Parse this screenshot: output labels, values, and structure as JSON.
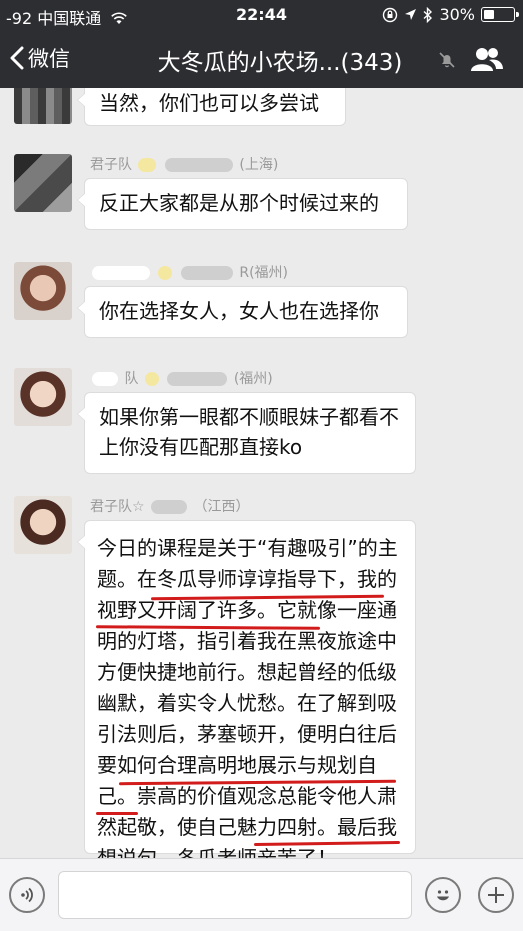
{
  "status_bar": {
    "carrier": "-92 中国联通",
    "time": "22:44",
    "battery": "30%",
    "battery_level": 0.3
  },
  "nav": {
    "back_label": "微信",
    "title": "大冬瓜的小农场...(343)"
  },
  "messages": [
    {
      "sender": "",
      "text": "当然，你们也可以多尝试"
    },
    {
      "sender": "君子队",
      "sender_suffix": "(上海)",
      "text": "反正大家都是从那个时候过来的"
    },
    {
      "sender": "",
      "sender_suffix": "R(福州)",
      "text": "你在选择女人，女人也在选择你"
    },
    {
      "sender": "队",
      "sender_suffix": "(福州)",
      "text": "如果你第一眼都不顺眼妹子都看不上你没有匹配那直接ko"
    },
    {
      "sender": "君子队☆",
      "sender_suffix": "（江西）",
      "text": "今日的课程是关于“有趣吸引”的主题。在冬瓜导师谆谆指导下，我的视野又开阔了许多。它就像一座通明的灯塔，指引着我在黑夜旅途中方便快捷地前行。想起曾经的低级幽默，着实令人忧愁。在了解到吸引法则后，茅塞顿开，便明白往后要如何合理高明地展示与规划自己。崇高的价值观念总能令他人肃然起敬，使自己魅力四射。最后我想说句，冬瓜老师辛苦了！"
    }
  ],
  "colors": {
    "header_bg": "#2d2e32",
    "chat_bg": "#ebebeb",
    "underline": "#d21c1c"
  }
}
